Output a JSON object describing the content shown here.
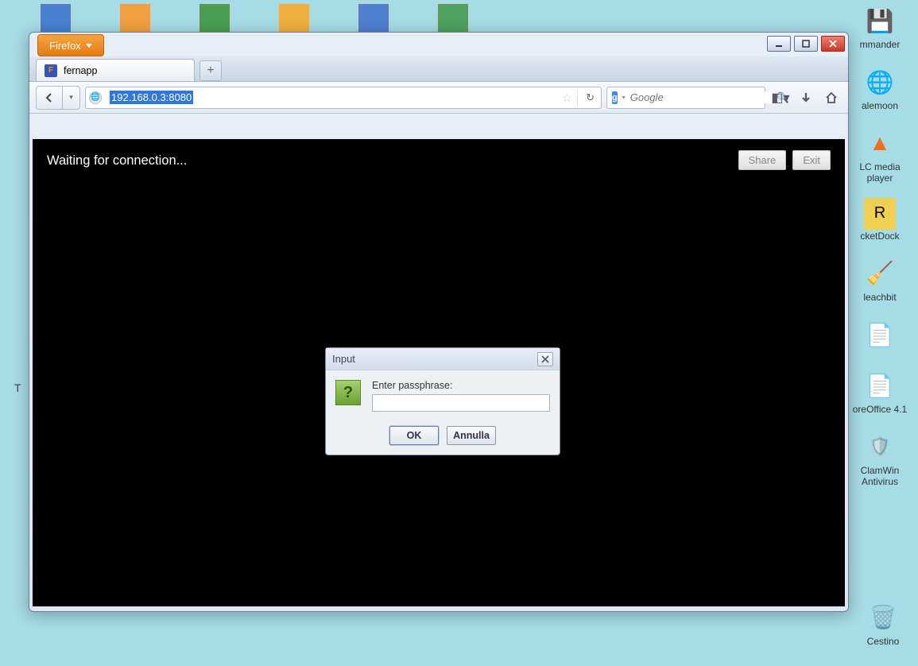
{
  "desktop": {
    "right_icons": [
      {
        "label": "mmander"
      },
      {
        "label": "alemoon"
      },
      {
        "label": "LC media player"
      },
      {
        "label": "cketDock"
      },
      {
        "label": "leachbit"
      },
      {
        "label": ""
      },
      {
        "label": "oreOffice 4.1"
      },
      {
        "label": "ClamWin Antivirus"
      },
      {
        "label": "Cestino"
      }
    ],
    "edge_char": "T"
  },
  "firefox": {
    "menu_label": "Firefox",
    "tab": {
      "title": "fernapp"
    },
    "newtab_glyph": "+",
    "url": "192.168.0.3:8080",
    "search": {
      "placeholder": "Google",
      "engine_glyph": "g"
    },
    "content": {
      "status": "Waiting for connection...",
      "buttons": {
        "share": "Share",
        "exit": "Exit"
      }
    }
  },
  "dialog": {
    "title": "Input",
    "icon_glyph": "?",
    "label": "Enter passphrase:",
    "input_value": "",
    "ok": "OK",
    "cancel": "Annulla"
  }
}
